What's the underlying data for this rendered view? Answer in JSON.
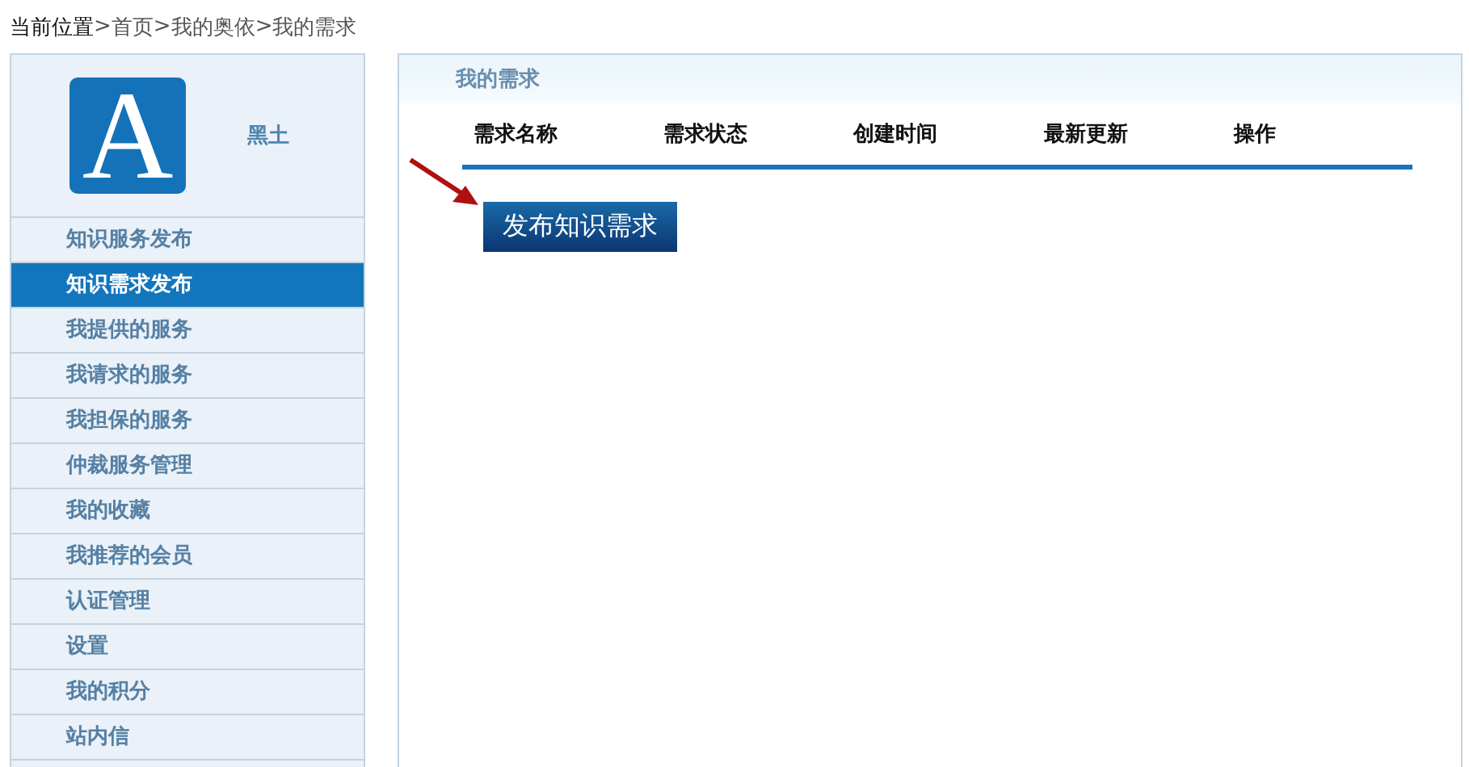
{
  "breadcrumb": {
    "label": "当前位置",
    "items": [
      {
        "separator": ">",
        "text": "首页"
      },
      {
        "separator": ">",
        "text": "我的奥依"
      },
      {
        "separator": ">",
        "text": "我的需求"
      }
    ]
  },
  "sidebar": {
    "logo": {
      "letter": "A"
    },
    "username": "黑土",
    "items": [
      {
        "label": "知识服务发布",
        "selected": false
      },
      {
        "label": "知识需求发布",
        "selected": true
      },
      {
        "label": "我提供的服务",
        "selected": false
      },
      {
        "label": "我请求的服务",
        "selected": false
      },
      {
        "label": "我担保的服务",
        "selected": false
      },
      {
        "label": "仲裁服务管理",
        "selected": false
      },
      {
        "label": "我的收藏",
        "selected": false
      },
      {
        "label": "我推荐的会员",
        "selected": false
      },
      {
        "label": "认证管理",
        "selected": false
      },
      {
        "label": "设置",
        "selected": false
      },
      {
        "label": "我的积分",
        "selected": false
      },
      {
        "label": "站内信",
        "selected": false
      }
    ]
  },
  "panel": {
    "title": "我的需求",
    "table": {
      "columns": [
        "需求名称",
        "需求状态",
        "创建时间",
        "最新更新",
        "操作"
      ]
    },
    "button": "发布知识需求"
  }
}
